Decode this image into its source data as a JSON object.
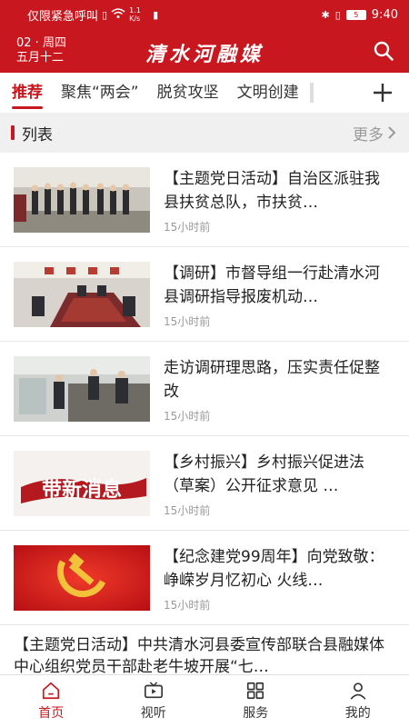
{
  "status_bar": {
    "left_text": "仅限紧急呼叫",
    "net_speed": "1.1 K/s",
    "battery": "5",
    "time": "9:40"
  },
  "header": {
    "date_line1": "02 · 周四",
    "date_line2": "五月十二",
    "app_title": "清水河融媒",
    "search_icon": "search-icon",
    "accent_color": "#c8171f"
  },
  "tabs": [
    {
      "label": "推荐",
      "active": true
    },
    {
      "label": "聚焦“两会”",
      "active": false
    },
    {
      "label": "脱贫攻坚",
      "active": false
    },
    {
      "label": "文明创建",
      "active": false
    }
  ],
  "section": {
    "title": "列表",
    "more": "更多"
  },
  "news": [
    {
      "title": "【主题党日活动】自治区派驻我县扶贫总队，市扶贫…",
      "time": "15小时前",
      "thumb_icon": "group-photo-image"
    },
    {
      "title": "【调研】市督导组一行赴清水河县调研指导报废机动…",
      "time": "15小时前",
      "thumb_icon": "meeting-room-image"
    },
    {
      "title": "走访调研理思路，压实责任促整改",
      "time": "15小时前",
      "thumb_icon": "office-visit-image"
    },
    {
      "title": "【乡村振兴】乡村振兴促进法（草案）公开征求意见 …",
      "time": "15小时前",
      "thumb_icon": "calligraphy-banner-image",
      "thumb_text": "带新消息"
    },
    {
      "title": "【纪念建党99周年】向党致敬：峥嵘岁月忆初心 火线…",
      "time": "15小时前",
      "thumb_icon": "party-emblem-image"
    }
  ],
  "text_news": {
    "title": "【主题党日活动】中共清水河县委宣传部联合县融媒体中心组织党员干部赴老牛坡开展“七…"
  },
  "bottom_nav": [
    {
      "label": "首页",
      "icon": "home-icon",
      "active": true
    },
    {
      "label": "视听",
      "icon": "video-icon",
      "active": false
    },
    {
      "label": "服务",
      "icon": "grid-icon",
      "active": false
    },
    {
      "label": "我的",
      "icon": "user-icon",
      "active": false
    }
  ]
}
